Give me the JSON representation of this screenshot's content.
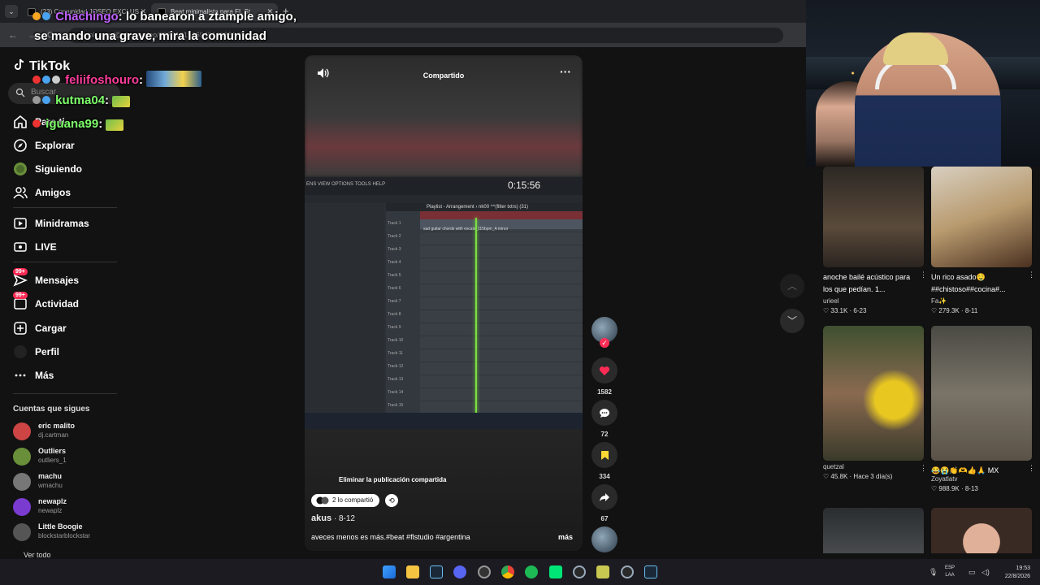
{
  "browser": {
    "tabs": [
      {
        "label": "(23) Comunidad JOSEO EXCLUS"
      },
      {
        "label": "Beat minimalista para FL St"
      }
    ],
    "url": "tiktok.com/@akus/video/757710152694516988868"
  },
  "chat": [
    {
      "user": "Chachingo",
      "sep": ":",
      "msg": " lo banearon a ztample amigo,",
      "color": "purple"
    },
    {
      "user": "",
      "sep": "",
      "msg": "se mando una grave, mira la comunidad",
      "color": "none"
    },
    {
      "user": "feliifoshouro",
      "sep": ":",
      "msg": "",
      "color": "pink"
    },
    {
      "user": "kutma04",
      "sep": ":",
      "msg": "",
      "color": "green"
    },
    {
      "user": "iguana99",
      "sep": ":",
      "msg": "",
      "color": "green"
    }
  ],
  "sidebar": {
    "logo": "TikTok",
    "search_placeholder": "Buscar",
    "items": [
      {
        "label": "Para ti",
        "icon": "home-icon"
      },
      {
        "label": "Explorar",
        "icon": "compass-icon"
      },
      {
        "label": "Siguiendo",
        "icon": "following-icon"
      },
      {
        "label": "Amigos",
        "icon": "friends-icon"
      },
      {
        "label": "Minidramas",
        "icon": "minidramas-icon"
      },
      {
        "label": "LIVE",
        "icon": "live-icon"
      },
      {
        "label": "Mensajes",
        "icon": "messages-icon",
        "badge": "99+"
      },
      {
        "label": "Actividad",
        "icon": "activity-icon",
        "badge": "99+"
      },
      {
        "label": "Cargar",
        "icon": "upload-icon"
      },
      {
        "label": "Perfil",
        "icon": "profile-icon"
      },
      {
        "label": "Más",
        "icon": "more-icon"
      }
    ],
    "following_title": "Cuentas que sigues",
    "following": [
      {
        "name": "eric malito",
        "handle": "dj.cartman",
        "color": "#c44"
      },
      {
        "name": "Outliers",
        "handle": "outliers_1",
        "color": "#6a8f3a"
      },
      {
        "name": "machu",
        "handle": "wmachu",
        "color": "#777"
      },
      {
        "name": "newaplz",
        "handle": "newaplz",
        "color": "#7a3bd0"
      },
      {
        "name": "Little Boogie",
        "handle": "blockstarblockstar",
        "color": "#555"
      }
    ],
    "see_all": "Ver todo"
  },
  "video": {
    "header_label": "Compartido",
    "fl_menu": "ENS  VIEW  OPTIONS  TOOLS  HELP",
    "fl_time": "0:15:56",
    "fl_playlist_title": "Playlist - Arrangement › nk00 ^^(filter txtrs) (31)",
    "fl_clip_name": "sad guitar chords with vocals_115bpm_A minor",
    "tracks": [
      "Track 1",
      "Track 2",
      "Track 3",
      "Track 4",
      "Track 5",
      "Track 6",
      "Track 7",
      "Track 8",
      "Track 9",
      "Track 10",
      "Track 11",
      "Track 12",
      "Track 13",
      "Track 14",
      "Track 15"
    ],
    "remove_shared": "Eliminar la publicación compartida",
    "shared_count": "2 lo compartió",
    "author": "akus",
    "date": "8-12",
    "description": "aveces menos es más.#beat #flstudio #argentina",
    "more": "más"
  },
  "actions": {
    "likes": "1582",
    "comments": "72",
    "saves": "334",
    "shares": "67"
  },
  "recommended": [
    {
      "title": "anoche bailé acústico para los que pedían. 1...",
      "user": "urieel",
      "meta": "♡ 33.1K · 6-23",
      "thumb": "#3a3530"
    },
    {
      "title": "Un rico asado🤤 ##chistoso##cocina#...",
      "user": "Fa✨",
      "meta": "♡ 279.3K · 8-11",
      "thumb": "#b89a6e"
    },
    {
      "title": "",
      "user": "quetzal",
      "meta": "♡ 45.8K · Hace 3 día(s)",
      "thumb": "#6a5a3a"
    },
    {
      "title": "😂😭👏🫶👍🙏 MX",
      "user": "Zoyatlatv",
      "meta": "♡ 988.9K · 8-13",
      "thumb": "#5a5a52"
    },
    {
      "title": "",
      "user": "",
      "meta": "",
      "thumb": "#3a3d40"
    },
    {
      "title": "",
      "user": "",
      "meta": "",
      "thumb": "#c9a08a"
    }
  ],
  "taskbar": {
    "lang": "ESP",
    "region": "LAA",
    "time": "19:53",
    "date": "22/8/2026"
  }
}
